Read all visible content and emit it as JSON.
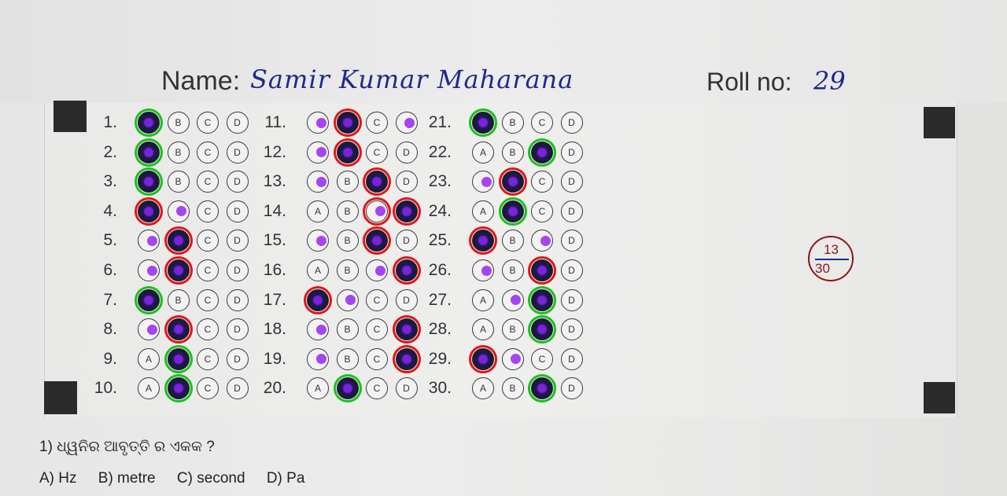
{
  "header": {
    "name_label": "Name:",
    "name_value": "Samir Kumar Maharana",
    "roll_label": "Roll no:",
    "roll_value": "29"
  },
  "score": {
    "obtained": "13",
    "total": "30"
  },
  "options_letters": [
    "A",
    "B",
    "C",
    "D"
  ],
  "colors": {
    "correct_ring": "#18c21a",
    "wrong_ring": "#e01616",
    "fill": "#15133a",
    "dot": "#a545f0"
  },
  "answers": [
    {
      "q": "1.",
      "filled": "A",
      "dots": [],
      "ring": "correct"
    },
    {
      "q": "2.",
      "filled": "A",
      "dots": [],
      "ring": "correct"
    },
    {
      "q": "3.",
      "filled": "A",
      "dots": [],
      "ring": "correct"
    },
    {
      "q": "4.",
      "filled": "A",
      "dots": [
        "B"
      ],
      "ring": "wrong"
    },
    {
      "q": "5.",
      "filled": "B",
      "dots": [
        "A"
      ],
      "ring": "wrong"
    },
    {
      "q": "6.",
      "filled": "B",
      "dots": [
        "A"
      ],
      "ring": "wrong"
    },
    {
      "q": "7.",
      "filled": "A",
      "dots": [],
      "ring": "correct"
    },
    {
      "q": "8.",
      "filled": "B",
      "dots": [
        "A"
      ],
      "ring": "wrong"
    },
    {
      "q": "9.",
      "filled": "B",
      "dots": [],
      "ring": "correct"
    },
    {
      "q": "10.",
      "filled": "B",
      "dots": [],
      "ring": "correct"
    },
    {
      "q": "11.",
      "filled": "B",
      "dots": [
        "A",
        "D"
      ],
      "ring": "wrong"
    },
    {
      "q": "12.",
      "filled": "B",
      "dots": [
        "A"
      ],
      "ring": "wrong"
    },
    {
      "q": "13.",
      "filled": "C",
      "dots": [
        "A"
      ],
      "ring": "wrong"
    },
    {
      "q": "14.",
      "filled": "D",
      "dots": [
        "C"
      ],
      "ring": "wrong",
      "extra_ring": "C"
    },
    {
      "q": "15.",
      "filled": "C",
      "dots": [
        "A"
      ],
      "ring": "wrong"
    },
    {
      "q": "16.",
      "filled": "D",
      "dots": [
        "C"
      ],
      "ring": "wrong"
    },
    {
      "q": "17.",
      "filled": "A",
      "dots": [
        "B"
      ],
      "ring": "wrong"
    },
    {
      "q": "18.",
      "filled": "D",
      "dots": [
        "A"
      ],
      "ring": "wrong"
    },
    {
      "q": "19.",
      "filled": "D",
      "dots": [
        "A"
      ],
      "ring": "wrong"
    },
    {
      "q": "20.",
      "filled": "B",
      "dots": [],
      "ring": "correct"
    },
    {
      "q": "21.",
      "filled": "A",
      "dots": [],
      "ring": "correct"
    },
    {
      "q": "22.",
      "filled": "C",
      "dots": [],
      "ring": "correct"
    },
    {
      "q": "23.",
      "filled": "B",
      "dots": [
        "A"
      ],
      "ring": "wrong"
    },
    {
      "q": "24.",
      "filled": "B",
      "dots": [],
      "ring": "correct"
    },
    {
      "q": "25.",
      "filled": "A",
      "dots": [
        "C"
      ],
      "ring": "wrong"
    },
    {
      "q": "26.",
      "filled": "C",
      "dots": [
        "A"
      ],
      "ring": "wrong"
    },
    {
      "q": "27.",
      "filled": "C",
      "dots": [
        "B"
      ],
      "ring": "correct"
    },
    {
      "q": "28.",
      "filled": "C",
      "dots": [],
      "ring": "correct"
    },
    {
      "q": "29.",
      "filled": "A",
      "dots": [
        "B"
      ],
      "ring": "wrong"
    },
    {
      "q": "30.",
      "filled": "C",
      "dots": [],
      "ring": "correct"
    }
  ],
  "question": {
    "text": "1) ଧ୍ୱନିର ଆବୃତ୍ତି ର ଏକକ ?",
    "options": [
      "A) Hz",
      "B) metre",
      "C) second",
      "D) Pa"
    ]
  }
}
